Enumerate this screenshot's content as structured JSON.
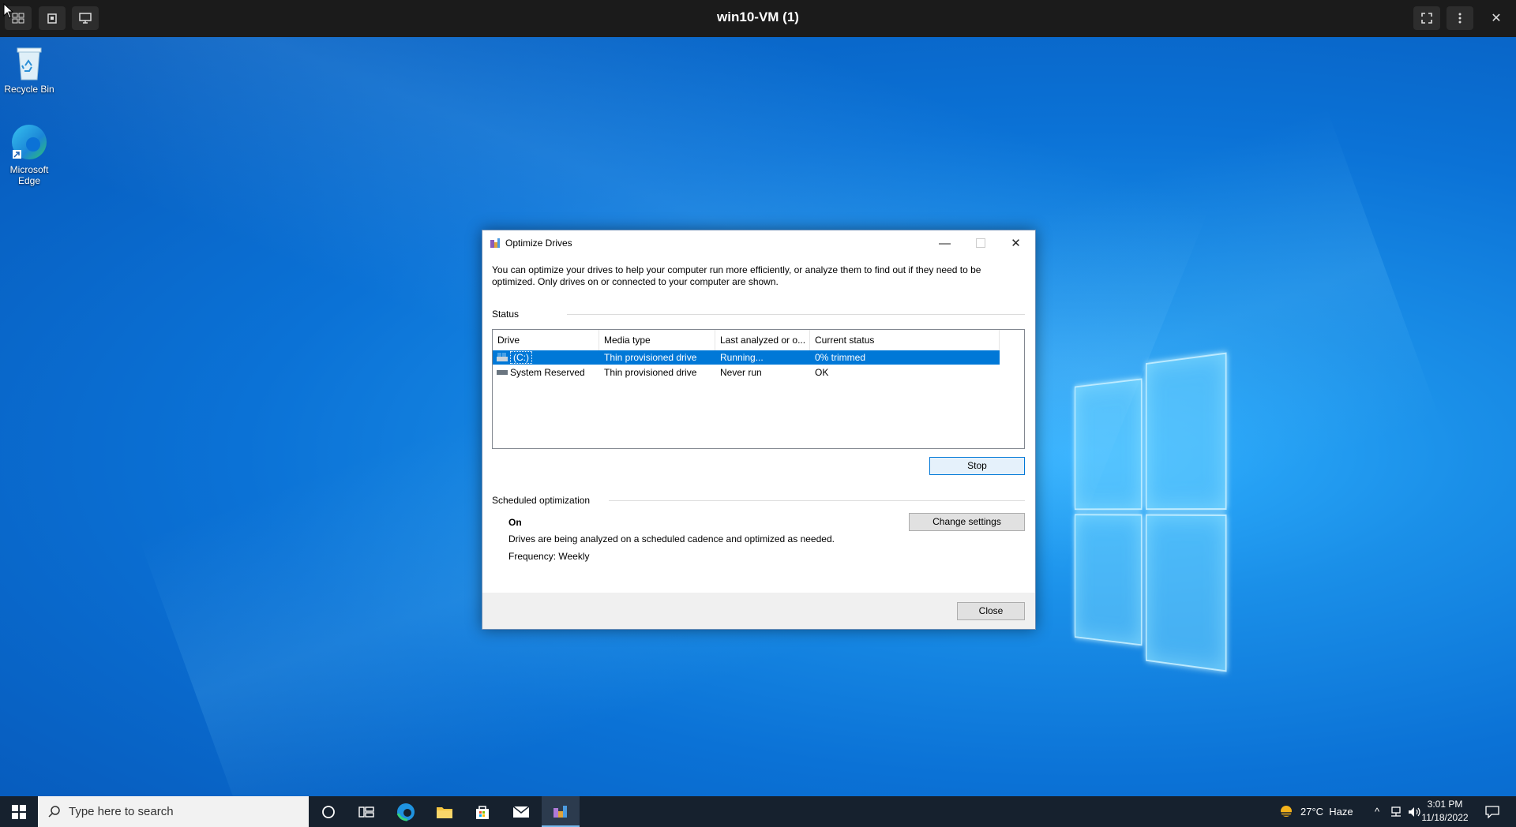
{
  "vm_bar": {
    "title": "win10-VM (1)"
  },
  "desktop_icons": [
    {
      "label": "Recycle Bin"
    },
    {
      "label": "Microsoft Edge"
    }
  ],
  "dialog": {
    "title": "Optimize Drives",
    "intro": "You can optimize your drives to help your computer run more efficiently, or analyze them to find out if they need to be optimized. Only drives on or connected to your computer are shown.",
    "status_label": "Status",
    "columns": [
      "Drive",
      "Media type",
      "Last analyzed or o...",
      "Current status"
    ],
    "rows": [
      {
        "drive": "(C:)",
        "media": "Thin provisioned drive",
        "last": "Running...",
        "status": "0% trimmed",
        "selected": true
      },
      {
        "drive": "System Reserved",
        "media": "Thin provisioned drive",
        "last": "Never run",
        "status": "OK",
        "selected": false
      }
    ],
    "stop_label": "Stop",
    "scheduled_label": "Scheduled optimization",
    "sched_state": "On",
    "sched_desc": "Drives are being analyzed on a scheduled cadence and optimized as needed.",
    "frequency": "Frequency: Weekly",
    "change_settings_label": "Change settings",
    "close_label": "Close"
  },
  "taskbar": {
    "search_placeholder": "Type here to search",
    "weather": "27°C  Haze",
    "time": "3:01 PM",
    "date": "11/18/2022"
  }
}
